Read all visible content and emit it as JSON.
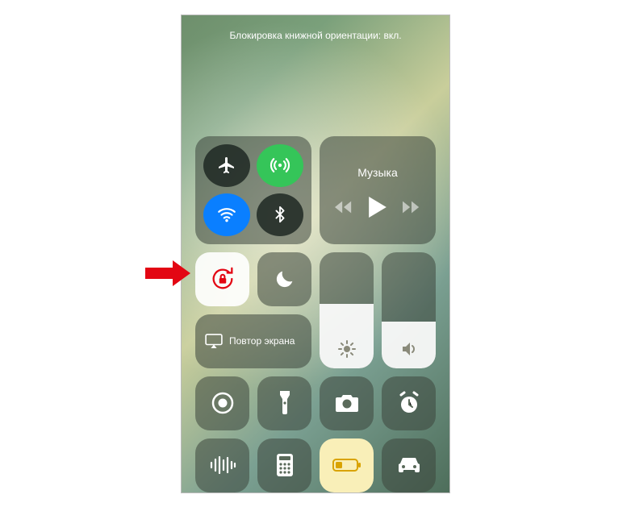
{
  "status": {
    "text": "Блокировка книжной ориентации: вкл."
  },
  "connectivity": {
    "airplane": false,
    "cellular": true,
    "wifi": true,
    "bluetooth": true
  },
  "music": {
    "title": "Музыка"
  },
  "orientation_lock": true,
  "do_not_disturb": false,
  "brightness": {
    "percent": 55
  },
  "volume": {
    "percent": 40
  },
  "mirroring": {
    "label": "Повтор экрана"
  },
  "shortcuts": [
    "screen-record",
    "flashlight",
    "camera",
    "alarm",
    "audio-wave",
    "calculator",
    "low-power",
    "carplay"
  ]
}
